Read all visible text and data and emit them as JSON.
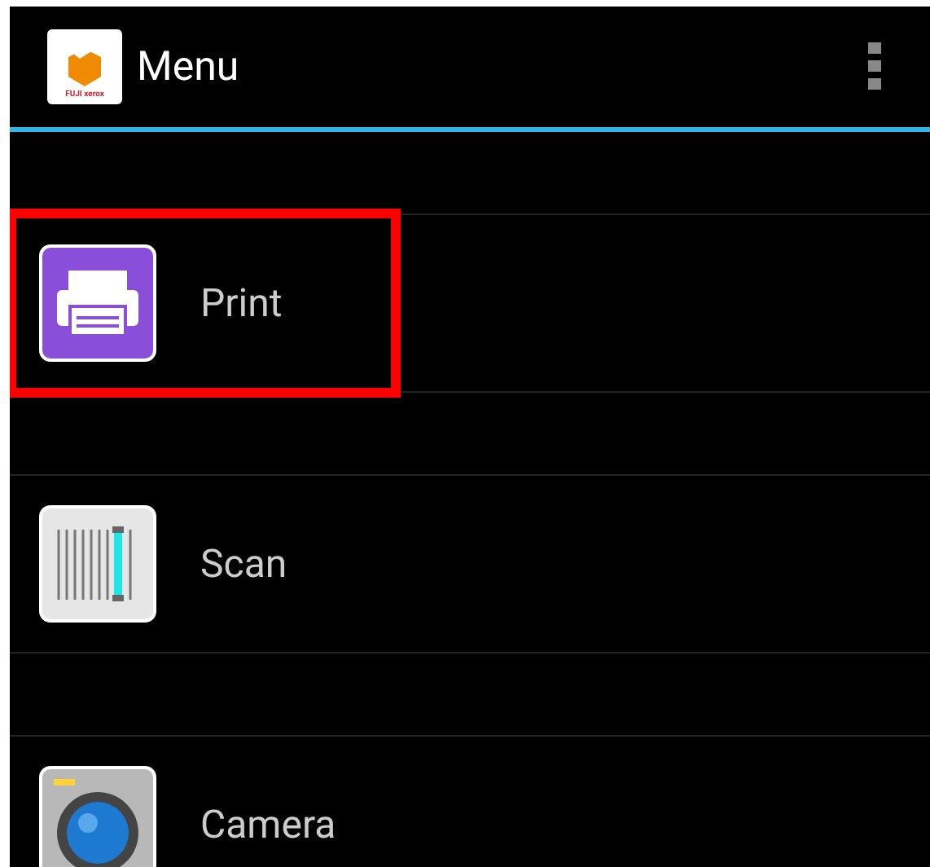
{
  "header": {
    "logo_text": "FUJI xerox",
    "title": "Menu"
  },
  "items": [
    {
      "kind": "print",
      "label": "Print",
      "highlighted": true
    },
    {
      "kind": "scan",
      "label": "Scan",
      "highlighted": false
    },
    {
      "kind": "camera",
      "label": "Camera",
      "highlighted": false
    }
  ]
}
